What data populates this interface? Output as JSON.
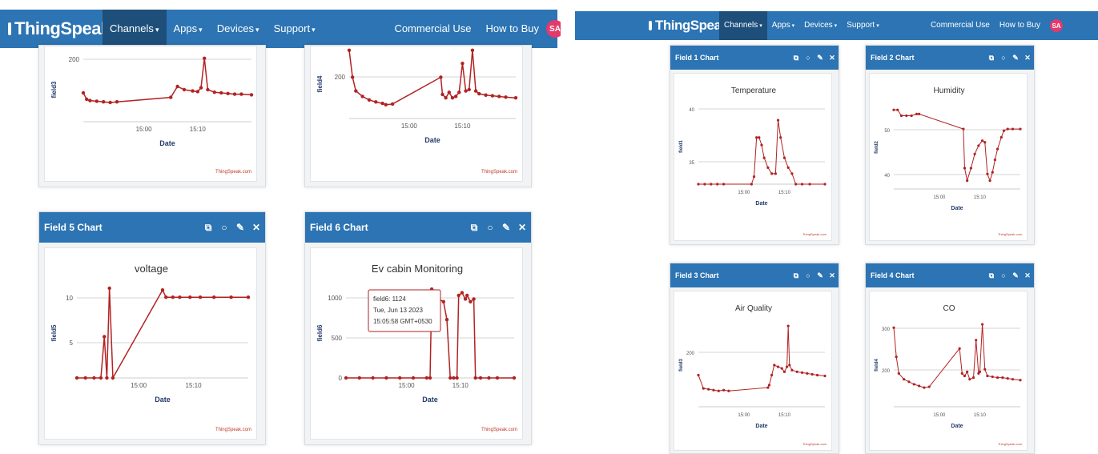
{
  "left": {
    "navbar": {
      "brand": "ThingSpeak",
      "tm": "™",
      "items": [
        {
          "label": "Channels",
          "active": true
        },
        {
          "label": "Apps",
          "active": false
        },
        {
          "label": "Devices",
          "active": false
        },
        {
          "label": "Support",
          "active": false
        }
      ],
      "right_items": [
        "Commercial Use",
        "How to Buy"
      ],
      "avatar": "SA"
    },
    "cards": [
      {
        "header": "",
        "chart_data": {
          "type": "line",
          "title": "",
          "xlabel": "Date",
          "ylabel": "field3",
          "ytick_labels": [
            "200"
          ],
          "xtick_labels": [
            "15:00",
            "15:10"
          ],
          "credit": "ThingSpeak.com",
          "color": "#b22222"
        }
      },
      {
        "header": "",
        "chart_data": {
          "type": "line",
          "title": "",
          "xlabel": "Date",
          "ylabel": "field4",
          "ytick_labels": [
            "200"
          ],
          "xtick_labels": [
            "15:00",
            "15:10"
          ],
          "credit": "ThingSpeak.com",
          "color": "#b22222"
        }
      },
      {
        "header": "Field 5 Chart",
        "chart_data": {
          "type": "line",
          "title": "voltage",
          "xlabel": "Date",
          "ylabel": "field5",
          "ytick_labels": [
            "10",
            "5"
          ],
          "xtick_labels": [
            "15:00",
            "15:10"
          ],
          "credit": "ThingSpeak.com",
          "color": "#b22222"
        }
      },
      {
        "header": "Field 6 Chart",
        "chart_data": {
          "type": "line",
          "title": "Ev cabin Monitoring",
          "xlabel": "Date",
          "ylabel": "field6",
          "ytick_labels": [
            "1000",
            "500",
            "0"
          ],
          "xtick_labels": [
            "15:00",
            "15:10"
          ],
          "credit": "ThingSpeak.com",
          "color": "#b22222",
          "tooltip": {
            "line1": "field6: 1124",
            "line2": "Tue, Jun 13 2023",
            "line3": "15:05:58 GMT+0530"
          }
        }
      }
    ]
  },
  "right": {
    "navbar": {
      "brand": "ThingSpeak",
      "tm": "™",
      "items": [
        {
          "label": "Channels",
          "active": true
        },
        {
          "label": "Apps",
          "active": false
        },
        {
          "label": "Devices",
          "active": false
        },
        {
          "label": "Support",
          "active": false
        }
      ],
      "right_items": [
        "Commercial Use",
        "How to Buy"
      ],
      "avatar": "SA"
    },
    "cards": [
      {
        "header": "Field 1 Chart",
        "chart_data": {
          "type": "line",
          "title": "Temperature",
          "xlabel": "Date",
          "ylabel": "field1",
          "ytick_labels": [
            "40",
            "35"
          ],
          "xtick_labels": [
            "15:00",
            "15:10"
          ],
          "credit": "ThingSpeak.com",
          "color": "#b22222"
        }
      },
      {
        "header": "Field 2 Chart",
        "chart_data": {
          "type": "line",
          "title": "Humidity",
          "xlabel": "Date",
          "ylabel": "field2",
          "ytick_labels": [
            "50",
            "40"
          ],
          "xtick_labels": [
            "15:00",
            "15:10"
          ],
          "credit": "ThingSpeak.com",
          "color": "#b22222"
        }
      },
      {
        "header": "Field 3 Chart",
        "chart_data": {
          "type": "line",
          "title": "Air Quality",
          "xlabel": "Date",
          "ylabel": "field3",
          "ytick_labels": [
            "200"
          ],
          "xtick_labels": [
            "15:00",
            "15:10"
          ],
          "credit": "ThingSpeak.com",
          "color": "#b22222"
        }
      },
      {
        "header": "Field 4 Chart",
        "chart_data": {
          "type": "line",
          "title": "CO",
          "xlabel": "Date",
          "ylabel": "field4",
          "ytick_labels": [
            "300",
            "200"
          ],
          "xtick_labels": [
            "15:00",
            "15:10"
          ],
          "credit": "ThingSpeak.com",
          "color": "#b22222"
        }
      }
    ]
  },
  "series": {
    "air_quality": [
      [
        0.0,
        0.38
      ],
      [
        0.04,
        0.22
      ],
      [
        0.08,
        0.21
      ],
      [
        0.12,
        0.2
      ],
      [
        0.16,
        0.19
      ],
      [
        0.2,
        0.2
      ],
      [
        0.24,
        0.19
      ],
      [
        0.55,
        0.23
      ],
      [
        0.56,
        0.26
      ],
      [
        0.58,
        0.38
      ],
      [
        0.6,
        0.5
      ],
      [
        0.63,
        0.48
      ],
      [
        0.66,
        0.46
      ],
      [
        0.68,
        0.42
      ],
      [
        0.7,
        0.48
      ],
      [
        0.71,
        0.97
      ],
      [
        0.72,
        0.5
      ],
      [
        0.74,
        0.44
      ],
      [
        0.78,
        0.42
      ],
      [
        0.82,
        0.41
      ],
      [
        0.86,
        0.4
      ],
      [
        0.9,
        0.39
      ],
      [
        0.94,
        0.38
      ],
      [
        1.0,
        0.37
      ]
    ],
    "co": [
      [
        0.0,
        0.95
      ],
      [
        0.02,
        0.6
      ],
      [
        0.04,
        0.4
      ],
      [
        0.08,
        0.33
      ],
      [
        0.12,
        0.3
      ],
      [
        0.16,
        0.27
      ],
      [
        0.2,
        0.25
      ],
      [
        0.24,
        0.23
      ],
      [
        0.28,
        0.24
      ],
      [
        0.52,
        0.7
      ],
      [
        0.54,
        0.4
      ],
      [
        0.56,
        0.37
      ],
      [
        0.58,
        0.42
      ],
      [
        0.6,
        0.33
      ],
      [
        0.63,
        0.35
      ],
      [
        0.65,
        0.8
      ],
      [
        0.67,
        0.4
      ],
      [
        0.68,
        0.42
      ],
      [
        0.7,
        0.99
      ],
      [
        0.72,
        0.45
      ],
      [
        0.74,
        0.37
      ],
      [
        0.78,
        0.36
      ],
      [
        0.82,
        0.35
      ],
      [
        0.86,
        0.35
      ],
      [
        0.9,
        0.34
      ],
      [
        0.94,
        0.33
      ],
      [
        1.0,
        0.32
      ]
    ],
    "temperature": [
      [
        0.0,
        0.0
      ],
      [
        0.05,
        0.0
      ],
      [
        0.1,
        0.0
      ],
      [
        0.15,
        0.0
      ],
      [
        0.2,
        0.0
      ],
      [
        0.42,
        0.0
      ],
      [
        0.44,
        0.1
      ],
      [
        0.46,
        0.62
      ],
      [
        0.48,
        0.62
      ],
      [
        0.5,
        0.52
      ],
      [
        0.52,
        0.35
      ],
      [
        0.55,
        0.22
      ],
      [
        0.58,
        0.14
      ],
      [
        0.61,
        0.14
      ],
      [
        0.63,
        0.85
      ],
      [
        0.65,
        0.62
      ],
      [
        0.68,
        0.35
      ],
      [
        0.71,
        0.22
      ],
      [
        0.74,
        0.14
      ],
      [
        0.77,
        0.0
      ],
      [
        0.82,
        0.0
      ],
      [
        0.88,
        0.0
      ],
      [
        1.0,
        0.0
      ]
    ],
    "humidity": [
      [
        0.0,
        0.95
      ],
      [
        0.03,
        0.95
      ],
      [
        0.06,
        0.88
      ],
      [
        0.1,
        0.88
      ],
      [
        0.14,
        0.88
      ],
      [
        0.18,
        0.9
      ],
      [
        0.2,
        0.9
      ],
      [
        0.55,
        0.72
      ],
      [
        0.56,
        0.25
      ],
      [
        0.58,
        0.1
      ],
      [
        0.61,
        0.25
      ],
      [
        0.64,
        0.42
      ],
      [
        0.67,
        0.52
      ],
      [
        0.7,
        0.58
      ],
      [
        0.72,
        0.56
      ],
      [
        0.74,
        0.18
      ],
      [
        0.76,
        0.1
      ],
      [
        0.78,
        0.2
      ],
      [
        0.8,
        0.35
      ],
      [
        0.82,
        0.48
      ],
      [
        0.85,
        0.62
      ],
      [
        0.87,
        0.7
      ],
      [
        0.9,
        0.72
      ],
      [
        0.94,
        0.72
      ],
      [
        1.0,
        0.72
      ]
    ],
    "voltage": [
      [
        0.0,
        0.0
      ],
      [
        0.05,
        0.0
      ],
      [
        0.1,
        0.0
      ],
      [
        0.14,
        0.0
      ],
      [
        0.16,
        0.46
      ],
      [
        0.175,
        0.0
      ],
      [
        0.19,
        1.0
      ],
      [
        0.21,
        0.0
      ],
      [
        0.5,
        0.98
      ],
      [
        0.52,
        0.9
      ],
      [
        0.56,
        0.9
      ],
      [
        0.6,
        0.9
      ],
      [
        0.66,
        0.9
      ],
      [
        0.72,
        0.9
      ],
      [
        0.8,
        0.9
      ],
      [
        0.9,
        0.9
      ],
      [
        1.0,
        0.9
      ]
    ],
    "ev_cabin": [
      [
        0.0,
        0.0
      ],
      [
        0.08,
        0.0
      ],
      [
        0.16,
        0.0
      ],
      [
        0.24,
        0.0
      ],
      [
        0.32,
        0.0
      ],
      [
        0.4,
        0.0
      ],
      [
        0.48,
        0.0
      ],
      [
        0.5,
        0.0
      ],
      [
        0.51,
        0.99
      ],
      [
        0.53,
        0.95
      ],
      [
        0.55,
        0.88
      ],
      [
        0.58,
        0.85
      ],
      [
        0.6,
        0.65
      ],
      [
        0.62,
        0.0
      ],
      [
        0.64,
        0.0
      ],
      [
        0.66,
        0.0
      ],
      [
        0.67,
        0.92
      ],
      [
        0.69,
        0.95
      ],
      [
        0.71,
        0.88
      ],
      [
        0.72,
        0.92
      ],
      [
        0.74,
        0.85
      ],
      [
        0.76,
        0.88
      ],
      [
        0.77,
        0.0
      ],
      [
        0.8,
        0.0
      ],
      [
        0.85,
        0.0
      ],
      [
        0.9,
        0.0
      ],
      [
        1.0,
        0.0
      ]
    ],
    "left_field3": [
      [
        0.0,
        0.45
      ],
      [
        0.02,
        0.35
      ],
      [
        0.04,
        0.33
      ],
      [
        0.08,
        0.32
      ],
      [
        0.12,
        0.31
      ],
      [
        0.16,
        0.3
      ],
      [
        0.2,
        0.31
      ],
      [
        0.52,
        0.38
      ],
      [
        0.56,
        0.55
      ],
      [
        0.6,
        0.5
      ],
      [
        0.65,
        0.48
      ],
      [
        0.68,
        0.47
      ],
      [
        0.7,
        0.53
      ],
      [
        0.72,
        0.99
      ],
      [
        0.74,
        0.5
      ],
      [
        0.78,
        0.46
      ],
      [
        0.82,
        0.45
      ],
      [
        0.86,
        0.44
      ],
      [
        0.9,
        0.43
      ],
      [
        0.94,
        0.43
      ],
      [
        1.0,
        0.42
      ]
    ],
    "left_field4": [
      [
        0.0,
        0.99
      ],
      [
        0.02,
        0.6
      ],
      [
        0.04,
        0.4
      ],
      [
        0.08,
        0.32
      ],
      [
        0.12,
        0.27
      ],
      [
        0.16,
        0.24
      ],
      [
        0.2,
        0.22
      ],
      [
        0.22,
        0.2
      ],
      [
        0.26,
        0.21
      ],
      [
        0.55,
        0.6
      ],
      [
        0.56,
        0.35
      ],
      [
        0.58,
        0.3
      ],
      [
        0.6,
        0.38
      ],
      [
        0.62,
        0.3
      ],
      [
        0.64,
        0.32
      ],
      [
        0.66,
        0.38
      ],
      [
        0.68,
        0.8
      ],
      [
        0.7,
        0.4
      ],
      [
        0.72,
        0.42
      ],
      [
        0.74,
        0.99
      ],
      [
        0.76,
        0.4
      ],
      [
        0.78,
        0.36
      ],
      [
        0.82,
        0.34
      ],
      [
        0.86,
        0.33
      ],
      [
        0.9,
        0.32
      ],
      [
        0.94,
        0.31
      ],
      [
        1.0,
        0.3
      ]
    ]
  }
}
